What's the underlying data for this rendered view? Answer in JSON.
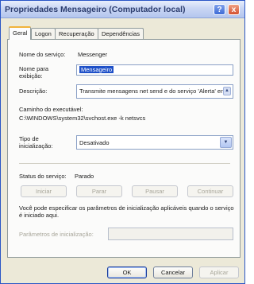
{
  "window": {
    "title": "Propriedades Mensageiro (Computador local)"
  },
  "titlebar_buttons": {
    "help": "?",
    "close": "x"
  },
  "tabs": [
    {
      "label": "Geral",
      "active": true
    },
    {
      "label": "Logon",
      "active": false
    },
    {
      "label": "Recuperação",
      "active": false
    },
    {
      "label": "Dependências",
      "active": false
    }
  ],
  "fields": {
    "service_name_label": "Nome do serviço:",
    "service_name_value": "Messenger",
    "display_name_label": "Nome para exibição:",
    "display_name_value": "Mensageiro",
    "description_label": "Descrição:",
    "description_value": "Transmite mensagens net send e do serviço 'Alerta' entre clientes e servidores.",
    "exec_path_label": "Caminho do executável:",
    "exec_path_value": "C:\\WINDOWS\\system32\\svchost.exe -k netsvcs",
    "startup_type_label": "Tipo de inicialização:",
    "startup_type_value": "Desativado"
  },
  "status": {
    "label": "Status do serviço:",
    "value": "Parado",
    "buttons": {
      "start": "Iniciar",
      "stop": "Parar",
      "pause": "Pausar",
      "resume": "Continuar"
    }
  },
  "params": {
    "note": "Você pode especificar os parâmetros de inicialização aplicáveis quando o serviço é iniciado aqui.",
    "label": "Parâmetros de inicialização:",
    "value": ""
  },
  "footer": {
    "ok": "OK",
    "cancel": "Cancelar",
    "apply": "Aplicar"
  }
}
